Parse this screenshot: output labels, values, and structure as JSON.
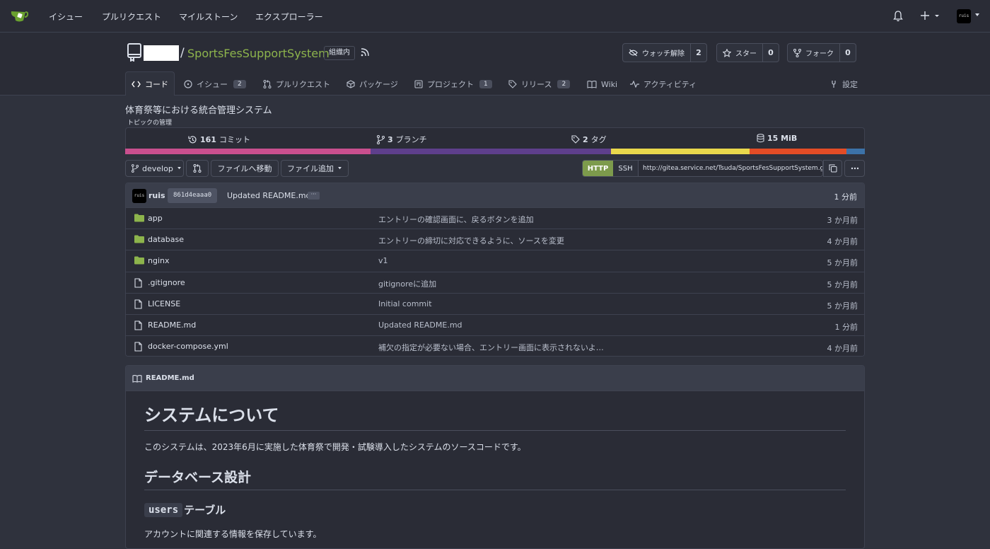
{
  "nav": {
    "items": [
      "イシュー",
      "プルリクエスト",
      "マイルストーン",
      "エクスプローラー"
    ],
    "avatar_text": "ruis"
  },
  "repo": {
    "name": "SportsFesSupportSystem",
    "visibility": "組織内",
    "watch_label": "ウォッチ解除",
    "watch_count": "2",
    "star_label": "スター",
    "star_count": "0",
    "fork_label": "フォーク",
    "fork_count": "0"
  },
  "tabs": [
    {
      "label": "コード",
      "count": ""
    },
    {
      "label": "イシュー",
      "count": "2"
    },
    {
      "label": "プルリクエスト",
      "count": ""
    },
    {
      "label": "パッケージ",
      "count": ""
    },
    {
      "label": "プロジェクト",
      "count": "1"
    },
    {
      "label": "リリース",
      "count": "2"
    },
    {
      "label": "Wiki",
      "count": ""
    },
    {
      "label": "アクティビティ",
      "count": ""
    },
    {
      "label": "設定",
      "count": ""
    }
  ],
  "description": "体育祭等における統合管理システム",
  "topics_label": "トピックの管理",
  "stats": {
    "commits_num": "161",
    "commits_label": "コミット",
    "branches_num": "3",
    "branches_label": "ブランチ",
    "tags_num": "2",
    "tags_label": "タグ",
    "size": "15 MiB"
  },
  "languages": [
    {
      "color": "#c94f8e",
      "percent": 33.2
    },
    {
      "color": "#5e3f8c",
      "percent": 32.5
    },
    {
      "color": "#e9d84c",
      "percent": 18.7
    },
    {
      "color": "#e34c26",
      "percent": 13.1
    },
    {
      "color": "#3c72a8",
      "percent": 2.5
    }
  ],
  "toolbar": {
    "branch": "develop",
    "goto_file": "ファイルへ移動",
    "add_file": "ファイル追加",
    "http": "HTTP",
    "ssh": "SSH",
    "clone_url": "http://gitea.service.net/Tsuda/SportsFesSupportSystem.git"
  },
  "last_commit": {
    "author": "ruis",
    "avatar_text": "ruis",
    "sha": "861d4eaaa0",
    "message": "Updated README.md",
    "time": "1 分前"
  },
  "files": [
    {
      "type": "dir",
      "name": "app",
      "message": "エントリーの確認画面に、戻るボタンを追加",
      "time": "3 か月前"
    },
    {
      "type": "dir",
      "name": "database",
      "message": "エントリーの締切に対応できるように、ソースを変更",
      "time": "4 か月前"
    },
    {
      "type": "dir",
      "name": "nginx",
      "message": "v1",
      "time": "5 か月前"
    },
    {
      "type": "file",
      "name": ".gitignore",
      "message": "gitignoreに追加",
      "time": "5 か月前"
    },
    {
      "type": "file",
      "name": "LICENSE",
      "message": "Initial commit",
      "time": "5 か月前"
    },
    {
      "type": "file",
      "name": "README.md",
      "message": "Updated README.md",
      "time": "1 分前"
    },
    {
      "type": "file",
      "name": "docker-compose.yml",
      "message": "補欠の指定が必要ない場合、エントリー画面に表示されないよ…",
      "time": "4 か月前"
    }
  ],
  "readme": {
    "filename": "README.md",
    "h1": "システムについて",
    "p1": "このシステムは、2023年6月に実施した体育祭で開発・試験導入したシステムのソースコードです。",
    "h2": "データベース設計",
    "h3_code": "users",
    "h3_text": "テーブル",
    "p2": "アカウントに関連する情報を保存しています。"
  }
}
